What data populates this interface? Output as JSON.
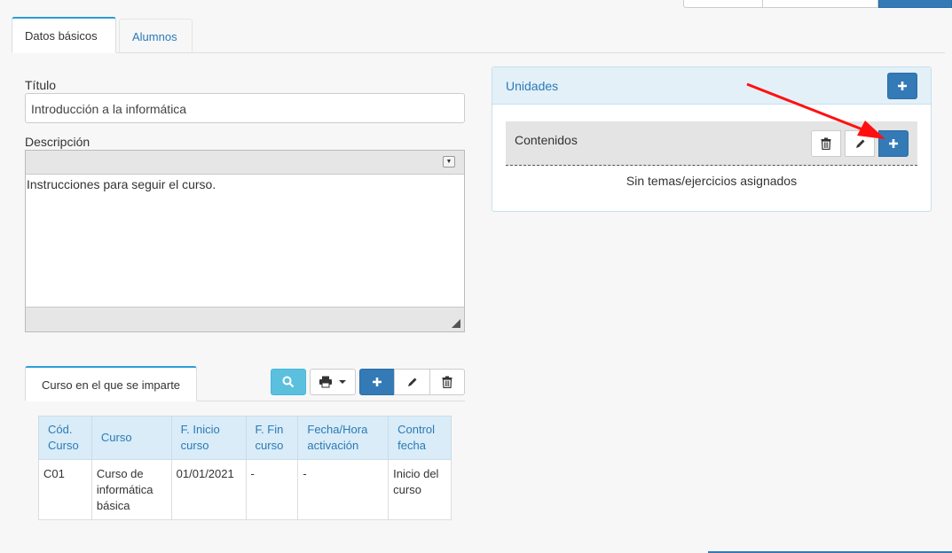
{
  "tabs": {
    "basic": "Datos básicos",
    "students": "Alumnos"
  },
  "form": {
    "title_label": "Título",
    "title_value": "Introducción a la informática",
    "description_label": "Descripción",
    "description_value": "Instrucciones para seguir el curso."
  },
  "course_section": {
    "tab_label": "Curso en el que se imparte",
    "toolbar_icons": [
      "search-icon",
      "print-icon",
      "plus-icon",
      "pencil-icon",
      "trash-icon"
    ],
    "columns": [
      "Cód. Curso",
      "Curso",
      "F. Inicio curso",
      "F. Fin curso",
      "Fecha/Hora activación",
      "Control fecha"
    ],
    "rows": [
      [
        "C01",
        "Curso de informática básica",
        "01/01/2021",
        "-",
        "-",
        "Inicio del curso"
      ]
    ]
  },
  "units_panel": {
    "title": "Unidades",
    "content_title": "Contenidos",
    "empty_text": "Sin temas/ejercicios asignados"
  },
  "colors": {
    "primary": "#337ab7",
    "info": "#5bc0de",
    "panel_head": "#e3f0f8",
    "annotation_arrow": "#ff0000"
  }
}
